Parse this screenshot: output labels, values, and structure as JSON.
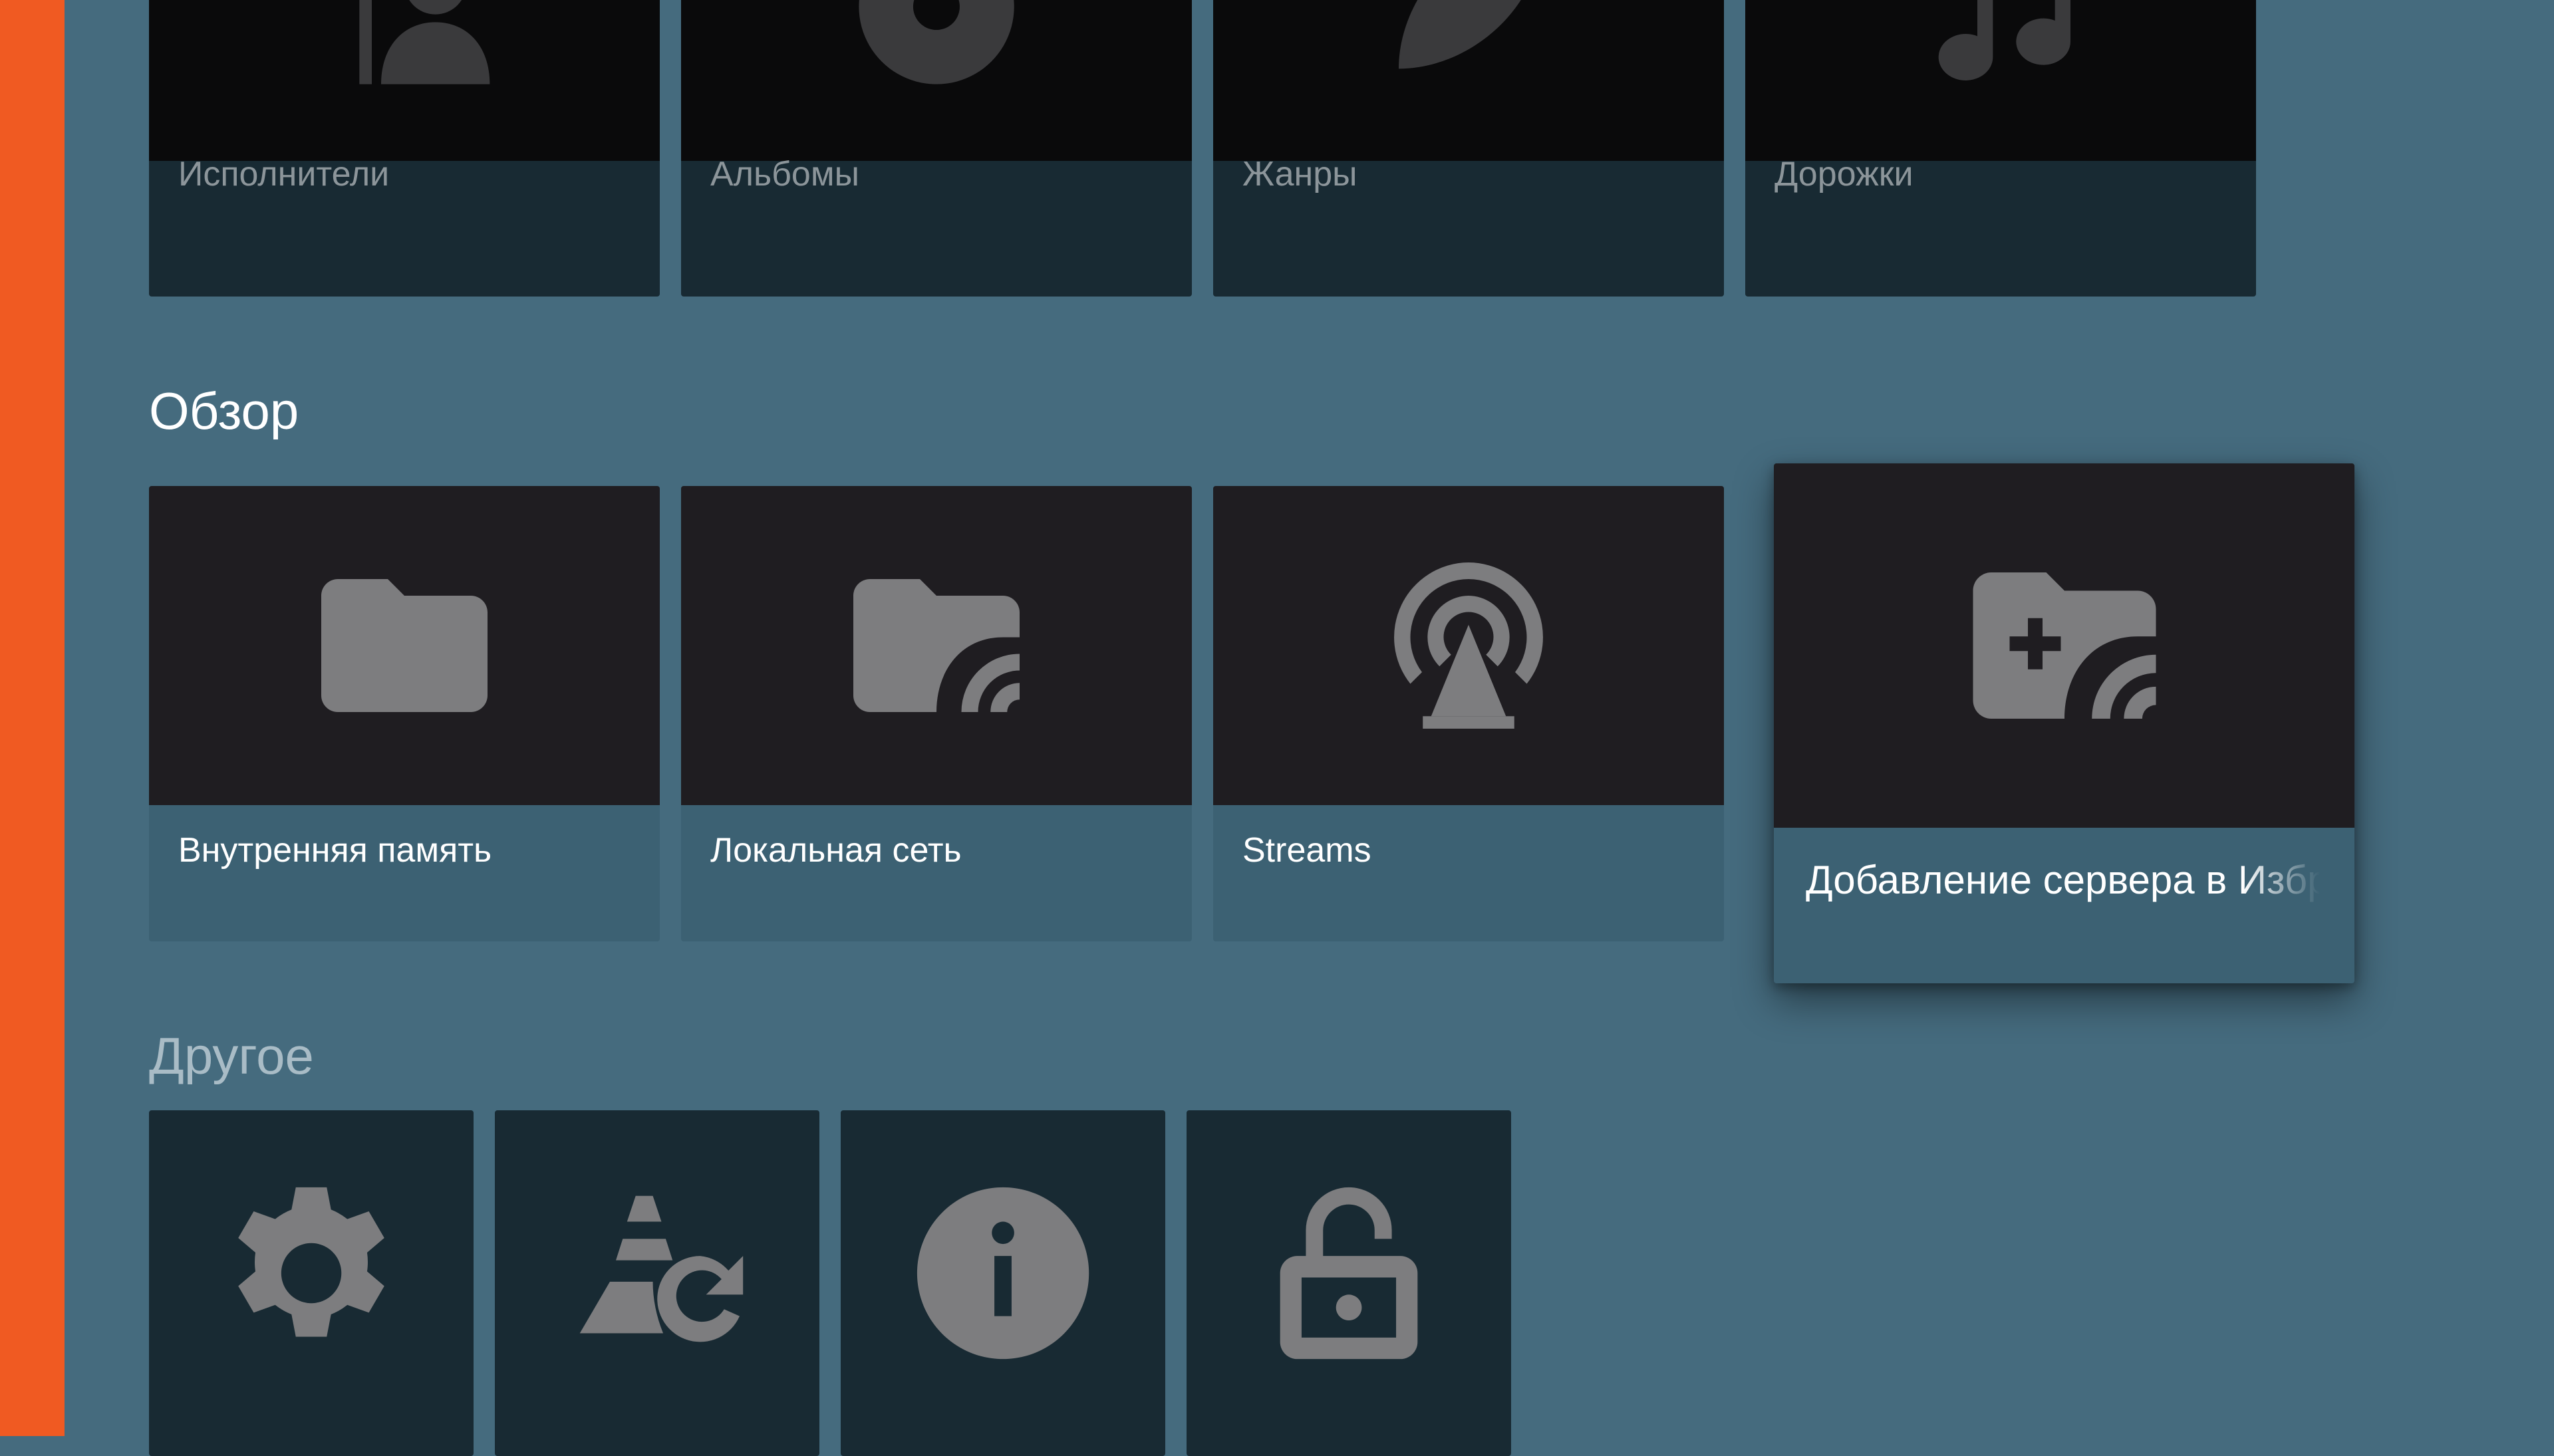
{
  "media": {
    "items": [
      {
        "label": "Исполнители",
        "icon": "artist-icon"
      },
      {
        "label": "Альбомы",
        "icon": "album-icon"
      },
      {
        "label": "Жанры",
        "icon": "genre-icon"
      },
      {
        "label": "Дорожки",
        "icon": "music-note-icon"
      }
    ]
  },
  "browse": {
    "title": "Обзор",
    "items": [
      {
        "label": "Внутренняя память",
        "icon": "folder-icon"
      },
      {
        "label": "Локальная сеть",
        "icon": "network-folder-icon"
      },
      {
        "label": "Streams",
        "icon": "stream-antenna-icon"
      },
      {
        "label": "Добавление сервера в Избранное",
        "icon": "add-network-folder-icon",
        "focused": true
      }
    ]
  },
  "other": {
    "title": "Другое",
    "items": [
      {
        "icon": "settings-gear-icon"
      },
      {
        "icon": "vlc-refresh-icon"
      },
      {
        "icon": "info-icon"
      },
      {
        "icon": "unlock-icon"
      }
    ]
  },
  "colors": {
    "accent": "#f05a22",
    "background": "#456b7e",
    "card_art": "#1f1d21",
    "card_label": "#3c6173",
    "muted_card": "#182a33",
    "icon": "#7d7d7f"
  }
}
